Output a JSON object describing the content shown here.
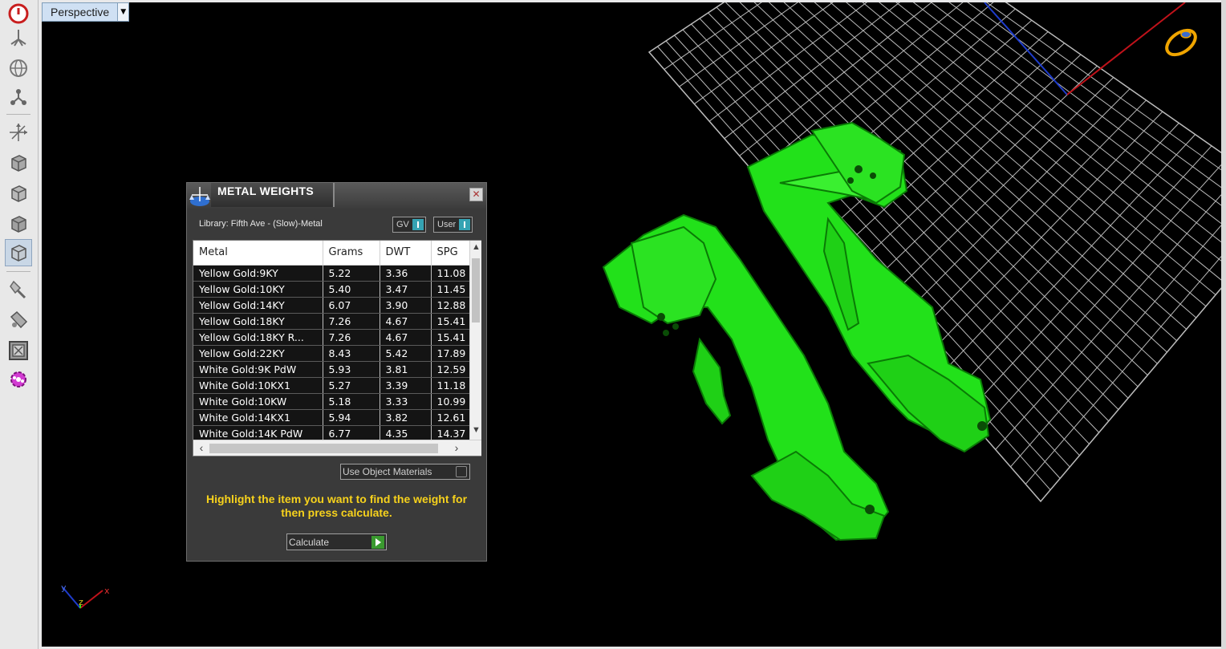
{
  "viewport": {
    "label": "Perspective",
    "axis_labels": {
      "x": "x",
      "y": "y",
      "z": "z"
    }
  },
  "toolbar": {
    "icons": [
      "power-icon",
      "tripod-icon",
      "globe-icon",
      "node-icon",
      "axes-move-icon",
      "box-view-icon",
      "box-view-icon",
      "box-view-icon",
      "box-view-active-icon",
      "paint-icon",
      "tools-icon",
      "panel-icon",
      "gear-icon"
    ]
  },
  "metal_weights": {
    "title": "METAL WEIGHTS",
    "close_glyph": "✕",
    "library": "Library: Fifth Ave - (Slow)-Metal",
    "toggle_gv": "GV",
    "toggle_user": "User",
    "columns": [
      "Metal",
      "Grams",
      "DWT",
      "SPG"
    ],
    "rows": [
      [
        "Yellow Gold:9KY",
        "5.22",
        "3.36",
        "11.08"
      ],
      [
        "Yellow Gold:10KY",
        "5.40",
        "3.47",
        "11.45"
      ],
      [
        "Yellow Gold:14KY",
        "6.07",
        "3.90",
        "12.88"
      ],
      [
        "Yellow Gold:18KY",
        "7.26",
        "4.67",
        "15.41"
      ],
      [
        "Yellow Gold:18KY R...",
        "7.26",
        "4.67",
        "15.41"
      ],
      [
        "Yellow Gold:22KY",
        "8.43",
        "5.42",
        "17.89"
      ],
      [
        "White Gold:9K PdW",
        "5.93",
        "3.81",
        "12.59"
      ],
      [
        "White Gold:10KX1",
        "5.27",
        "3.39",
        "11.18"
      ],
      [
        "White Gold:10KW",
        "5.18",
        "3.33",
        "10.99"
      ],
      [
        "White Gold:14KX1",
        "5.94",
        "3.82",
        "12.61"
      ],
      [
        "White Gold:14K PdW",
        "6.77",
        "4.35",
        "14.37"
      ]
    ],
    "use_object_materials": "Use Object Materials",
    "message": "Highlight the item you want to find the weight for then press calculate.",
    "calculate_label": "Calculate",
    "accent_color": "#f7d21c"
  },
  "colors": {
    "model": "#22e11a",
    "viewport_bg": "#000000",
    "grid": "#d0d0d0",
    "x_axis": "#c0121a",
    "y_axis": "#1e3ccc"
  }
}
